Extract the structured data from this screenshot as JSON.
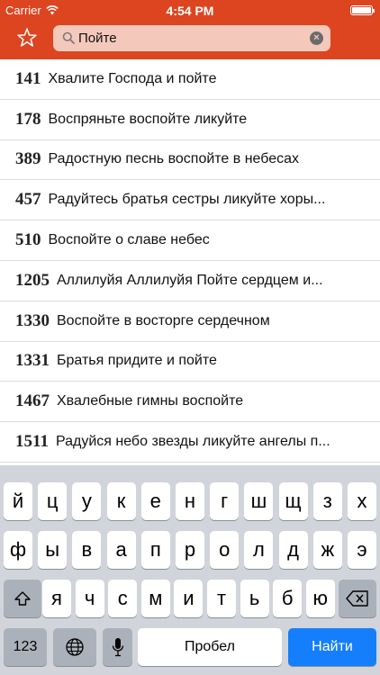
{
  "status_bar": {
    "carrier": "Carrier",
    "time": "4:54 PM",
    "battery_level": 1.0
  },
  "header": {
    "favorites_icon": "star-outline-icon",
    "search": {
      "value": "Пойте",
      "search_icon": "magnifier-icon",
      "clear_icon": "clear-x-icon"
    }
  },
  "results": [
    {
      "number": "141",
      "title": "Хвалите Господа и пойте"
    },
    {
      "number": "178",
      "title": "Воспряньте воспойте ликуйте"
    },
    {
      "number": "389",
      "title": "Радостную песнь воспойте в небесах"
    },
    {
      "number": "457",
      "title": "Радуйтесь братья сестры ликуйте хоры..."
    },
    {
      "number": "510",
      "title": "Воспойте о славе небес"
    },
    {
      "number": "1205",
      "title": "Аллилуйя Аллилуйя Пойте сердцем и..."
    },
    {
      "number": "1330",
      "title": "Воспойте в восторге сердечном"
    },
    {
      "number": "1331",
      "title": "Братья придите и пойте"
    },
    {
      "number": "1467",
      "title": "Хвалебные гимны воспойте"
    },
    {
      "number": "1511",
      "title": "Радуйся небо звезды ликуйте ангелы п..."
    }
  ],
  "keyboard": {
    "row1": [
      "й",
      "ц",
      "у",
      "к",
      "е",
      "н",
      "г",
      "ш",
      "щ",
      "з",
      "х"
    ],
    "row2": [
      "ф",
      "ы",
      "в",
      "а",
      "п",
      "р",
      "о",
      "л",
      "д",
      "ж",
      "э"
    ],
    "row3": [
      "я",
      "ч",
      "с",
      "м",
      "и",
      "т",
      "ь",
      "б",
      "ю"
    ],
    "numbers_label": "123",
    "space_label": "Пробел",
    "go_label": "Найти",
    "shift_icon": "shift-arrow-icon",
    "delete_icon": "backspace-icon",
    "globe_icon": "globe-icon",
    "mic_icon": "microphone-icon"
  }
}
